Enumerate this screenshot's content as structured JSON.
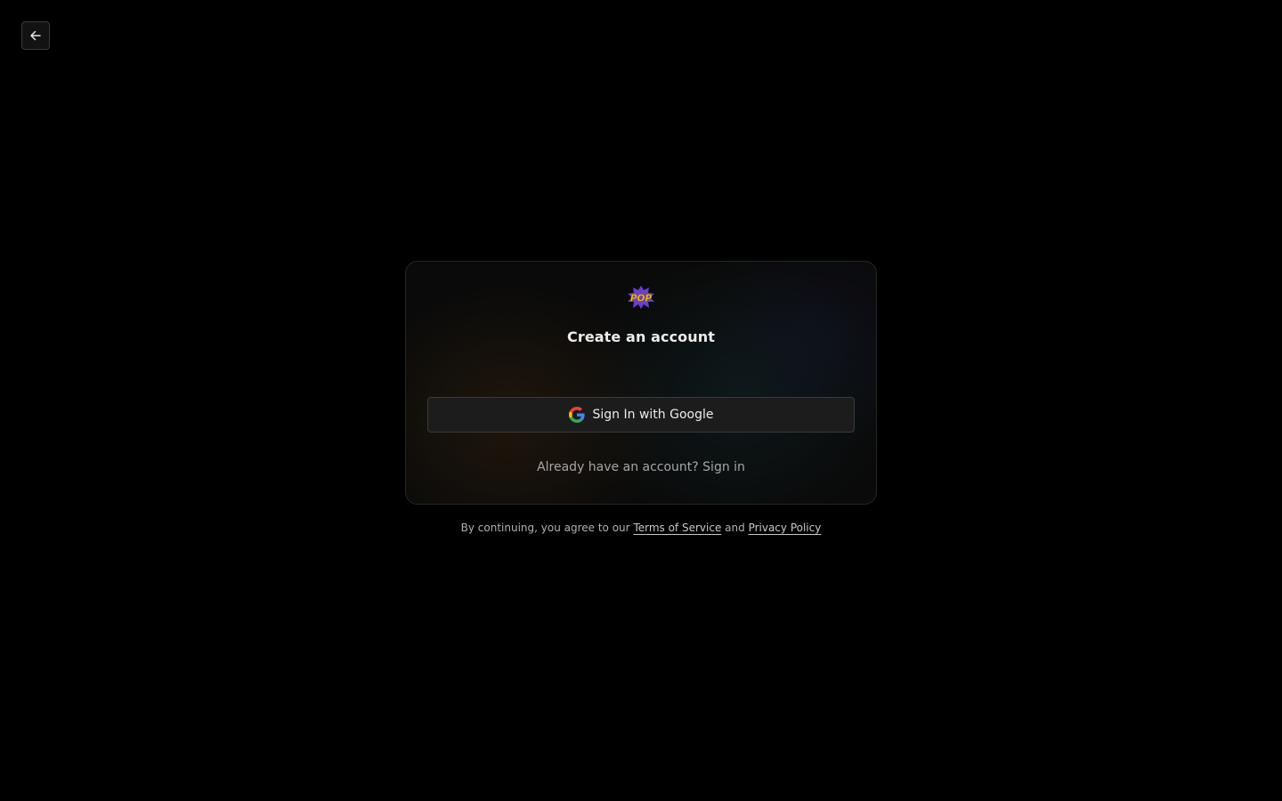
{
  "header": {
    "back_icon": "arrow-left-icon"
  },
  "card": {
    "logo_text": "POP",
    "title": "Create an account",
    "google_button": {
      "icon": "google-g-icon",
      "label": "Sign In with Google"
    },
    "already_text": "Already have an account?",
    "signin_link": "Sign in"
  },
  "footer": {
    "prefix": "By continuing, you agree to our",
    "terms_link": "Terms of Service",
    "conjunction": "and",
    "privacy_link": "Privacy Policy"
  },
  "colors": {
    "background": "#000000",
    "card_border": "#262626",
    "button_bg": "#1c1c1c",
    "logo_yellow": "#f5c518",
    "logo_purple": "#6b3fd1"
  }
}
